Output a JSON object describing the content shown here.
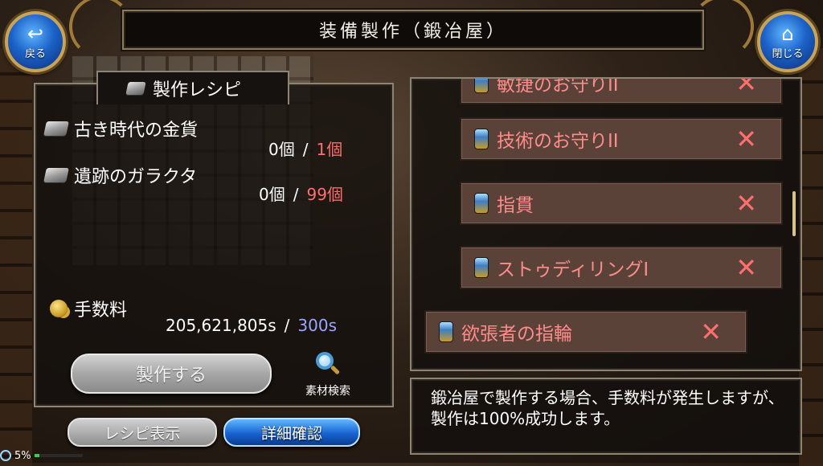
{
  "header": {
    "title": "装備製作（鍛冶屋）"
  },
  "nav": {
    "back": {
      "label": "戻る",
      "icon": "back-arrow-icon"
    },
    "close": {
      "label": "閉じる",
      "icon": "home-icon"
    }
  },
  "recipe": {
    "title": "製作レシピ",
    "materials": [
      {
        "name": "古き時代の金貨",
        "have": "0個",
        "need": "1個"
      },
      {
        "name": "遺跡のガラクタ",
        "have": "0個",
        "need": "99個"
      }
    ],
    "fee": {
      "label": "手数料",
      "have": "205,621,805s",
      "need": "300s"
    },
    "separator": "/",
    "craft_button": "製作する",
    "search_label": "素材検索"
  },
  "buttons": {
    "recipe_show": "レシピ表示",
    "detail": "詳細確認"
  },
  "equipment_list": {
    "items": [
      {
        "name": "敏捷のお守りII",
        "mark": "✕"
      },
      {
        "name": "技術のお守りII",
        "mark": "✕"
      },
      {
        "name": "指貫",
        "mark": "✕"
      },
      {
        "name": "ストゥディリングI",
        "mark": "✕"
      },
      {
        "name": "欲張者の指輪",
        "mark": "✕"
      }
    ]
  },
  "description": {
    "text": "鍛冶屋で製作する場合、手数料が発生しますが、製作は100%成功します。"
  },
  "status": {
    "battery_text": "5%",
    "battery_level": 0.05
  },
  "colors": {
    "insufficient": "#ff6e6e",
    "fee_need": "#9aa6ff",
    "item_text": "#ff8b8b",
    "detail_button": "#1763d2"
  }
}
